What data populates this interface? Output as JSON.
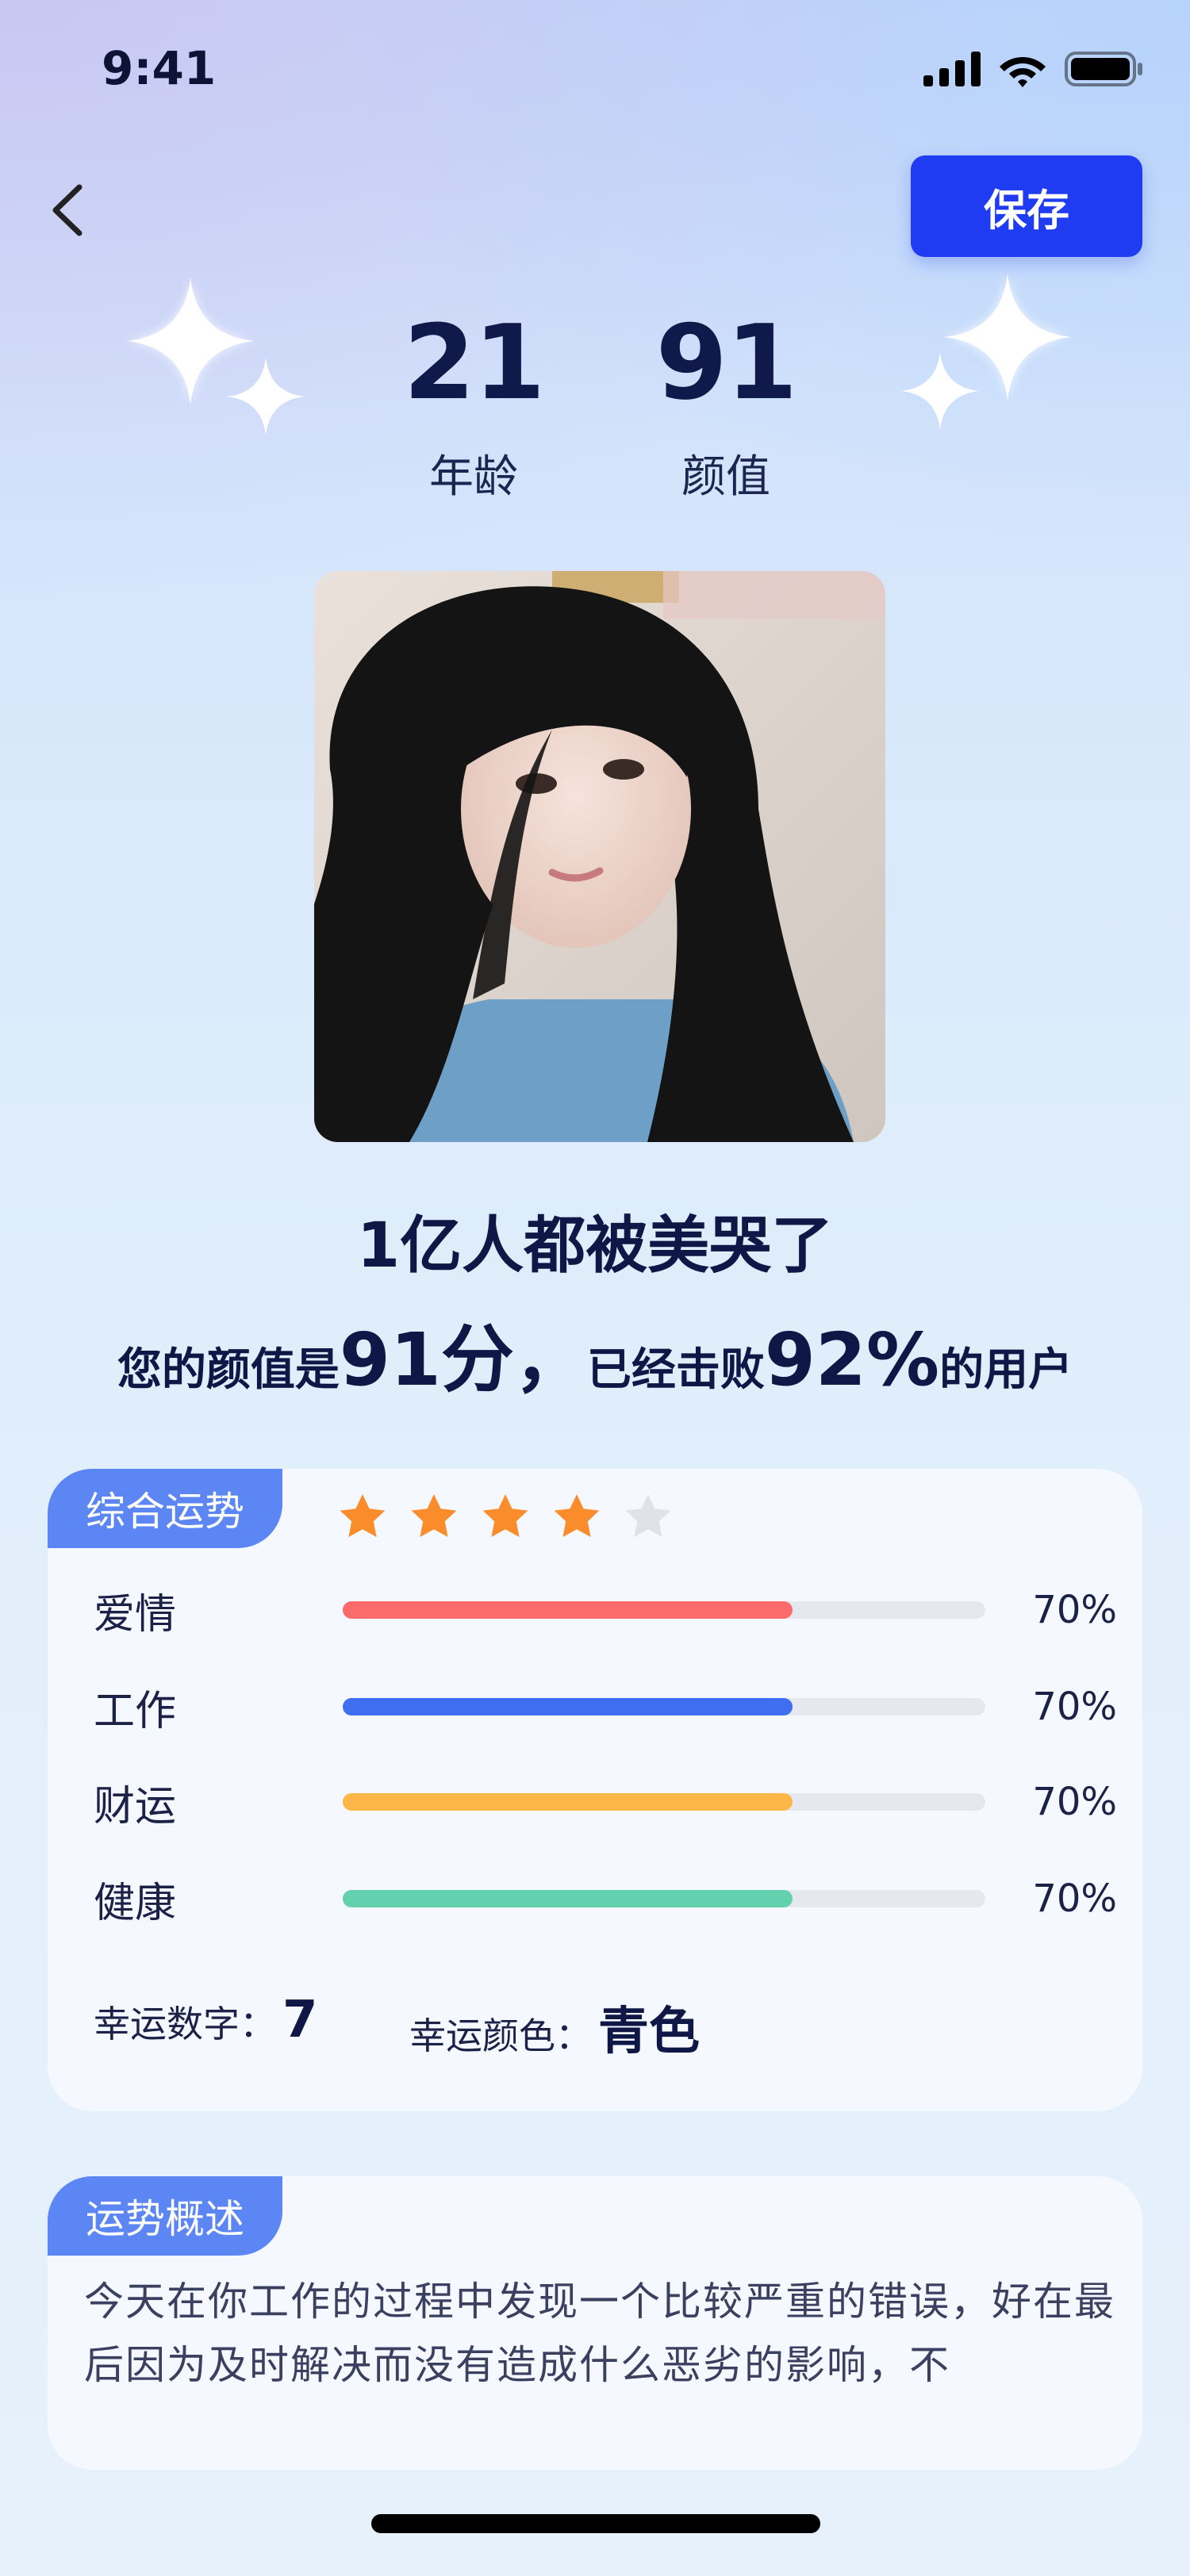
{
  "status_bar": {
    "time": "9:41"
  },
  "header": {
    "save_label": "保存"
  },
  "stats": {
    "age_value": "21",
    "age_label": "年龄",
    "score_value": "91",
    "score_label": "颜值"
  },
  "headline": "1亿人都被美哭了",
  "subline": {
    "prefix": "您的颜值是",
    "score": "91分",
    "comma": "，",
    "middle": "已经击败",
    "percent": "92%",
    "suffix": "的用户"
  },
  "fortune_card": {
    "tab_label": "综合运势",
    "rating": 4,
    "rating_max": 5,
    "rows": [
      {
        "label": "爱情",
        "percent_text": "70%",
        "value": 0.7,
        "color": "#fb6b6b"
      },
      {
        "label": "工作",
        "percent_text": "70%",
        "value": 0.7,
        "color": "#3f6ff0"
      },
      {
        "label": "财运",
        "percent_text": "70%",
        "value": 0.7,
        "color": "#fdb748"
      },
      {
        "label": "健康",
        "percent_text": "70%",
        "value": 0.7,
        "color": "#63d0ae"
      }
    ],
    "lucky_number_label": "幸运数字：",
    "lucky_number": "7",
    "lucky_color_label": "幸运颜色：",
    "lucky_color": "青色"
  },
  "summary_card": {
    "tab_label": "运势概述",
    "text": "今天在你工作的过程中发现一个比较严重的错误，好在最后因为及时解决而没有造成什么恶劣的影响，不"
  },
  "colors": {
    "accent": "#1f3cf2",
    "tab": "#5d86f5",
    "star_filled": "#fb8c2c",
    "star_empty": "#dfe2e8"
  },
  "icons": [
    "chevron-left-icon",
    "signal-icon",
    "wifi-icon",
    "battery-icon",
    "sparkle-icon",
    "star-icon"
  ]
}
